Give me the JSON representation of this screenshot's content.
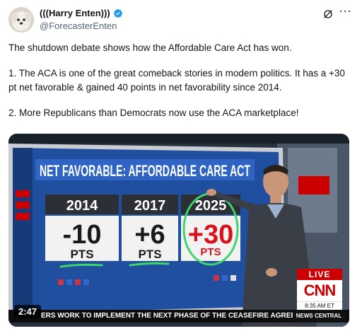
{
  "author": {
    "display_name": "(((Harry Enten)))",
    "handle": "@ForecasterEnten",
    "verified": true
  },
  "icons": {
    "verified": "verified-badge-icon",
    "grok": "grok-icon",
    "more": "more-icon"
  },
  "tweet": {
    "paragraphs": [
      "The shutdown debate shows how the Affordable Care Act has won.",
      "1. The ACA is one of the great comeback stories in modern politics. It has a +30 pt net favorable & gained 40 points in net favorability since 2014.",
      "2. More Republicans than Democrats now use the ACA marketplace!"
    ]
  },
  "video": {
    "timestamp": "2:47",
    "board_title": "NET FAVORABLE: AFFORDABLE CARE ACT",
    "columns": [
      {
        "year": "2014",
        "value": "-10",
        "unit": "PTS"
      },
      {
        "year": "2017",
        "value": "+6",
        "unit": "PTS"
      },
      {
        "year": "2025",
        "value": "+30",
        "unit": "PTS"
      }
    ],
    "live_label": "LIVE",
    "network": "CNN",
    "clock": "8:35 AM ET",
    "ticker": "ERS WORK TO IMPLEMENT THE NEXT PHASE OF THE CEASEFIRE AGREEMENT.",
    "ticker_section": "NEWS CENTRAL"
  },
  "colors": {
    "verified": "#1d9bf0",
    "cnn_red": "#cc0000",
    "board_blue": "#1f4f9e",
    "highlight_green": "#3ed36b",
    "text_secondary": "#536471"
  }
}
